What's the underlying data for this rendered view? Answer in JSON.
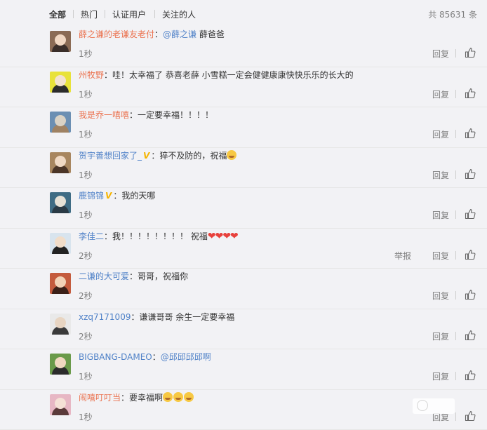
{
  "tabs": [
    "全部",
    "热门",
    "认证用户",
    "关注的人"
  ],
  "total": "共 85631 条",
  "comments": [
    {
      "user": "薛之谦的老谦友老付",
      "badge": "",
      "mention": "@薛之谦",
      "text": " 薛爸爸",
      "emoji": "",
      "time": "1秒",
      "report": "",
      "reply": "回复",
      "avatar_colors": [
        "#8b6b55",
        "#f1d7c2",
        "#3a2e2a"
      ]
    },
    {
      "user": "州牧野",
      "badge": "",
      "mention": "",
      "text": "哇！太幸福了 恭喜老薛 小雪糕一定会健健康康快快乐乐的长大的",
      "emoji": "",
      "time": "1秒",
      "report": "",
      "reply": "回复",
      "avatar_colors": [
        "#e8e23a",
        "#f3e2cf",
        "#2c2c2c"
      ]
    },
    {
      "user": "我是乔一嘻嘻",
      "badge": "",
      "mention": "",
      "text": "一定要幸福！！！！",
      "emoji": "",
      "time": "1秒",
      "report": "",
      "reply": "回复",
      "avatar_colors": [
        "#6b8fb3",
        "#d9d2c5",
        "#9f8263"
      ]
    },
    {
      "user": "贺宇善想回家了_",
      "badge": "V",
      "mention": "",
      "text": "猝不及防的，祝福",
      "emoji": "cry",
      "time": "1秒",
      "report": "",
      "reply": "回复",
      "avatar_colors": [
        "#a8865f",
        "#f0d9c4",
        "#4b3527"
      ]
    },
    {
      "user": "鹿锦锦",
      "badge": "V",
      "mention": "",
      "text": "我的天哪",
      "emoji": "",
      "time": "1秒",
      "report": "",
      "reply": "回复",
      "avatar_colors": [
        "#3f6c84",
        "#e6e1d6",
        "#2a3a45"
      ]
    },
    {
      "user": "李佳二",
      "badge": "",
      "mention": "",
      "text": "我！！！！！！！！  祝福",
      "emoji": "hearts",
      "time": "2秒",
      "report": "举报",
      "reply": "回复",
      "avatar_colors": [
        "#d8e4ee",
        "#f1ddc9",
        "#222222"
      ]
    },
    {
      "user": "二谦的大可爱",
      "badge": "",
      "mention": "",
      "text": "哥哥，祝福你",
      "emoji": "",
      "time": "2秒",
      "report": "",
      "reply": "回复",
      "avatar_colors": [
        "#c45b3d",
        "#f2d2b6",
        "#3b2018"
      ]
    },
    {
      "user": "xzq7171009",
      "badge": "",
      "mention": "",
      "text": "谦谦哥哥 余生一定要幸福",
      "emoji": "",
      "time": "2秒",
      "report": "",
      "reply": "回复",
      "avatar_colors": [
        "#e9e9e9",
        "#e8d5c2",
        "#3a3a3a"
      ]
    },
    {
      "user": "BIGBANG-DAMEO",
      "badge": "",
      "mention": "@邱邱邱邱啊",
      "text": "",
      "emoji": "",
      "time": "1秒",
      "report": "",
      "reply": "回复",
      "avatar_colors": [
        "#6a9a4a",
        "#f0d8c0",
        "#2b2b2b"
      ]
    },
    {
      "user": "闹嘻叮叮当",
      "badge": "",
      "mention": "",
      "text": "要幸福啊",
      "emoji": "cry3",
      "time": "1秒",
      "report": "",
      "reply": "回复",
      "avatar_colors": [
        "#e7b7c4",
        "#f5e1d6",
        "#5a3a3a"
      ]
    }
  ],
  "colors": {
    "username": "#eb7350",
    "link": "#5082c8",
    "muted": "#808080",
    "background": "#f2f2f5"
  },
  "icons": {
    "like": "thumbs-up-icon"
  }
}
